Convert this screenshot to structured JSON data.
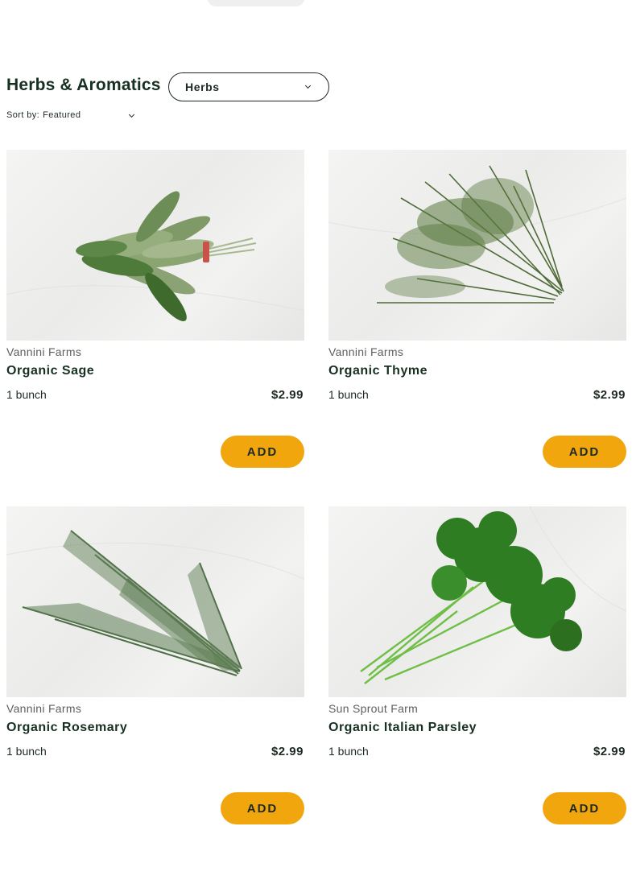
{
  "section": {
    "title": "Herbs & Aromatics",
    "category_select": "Herbs",
    "sort_label": "Sort by:",
    "sort_value": "Featured"
  },
  "products": [
    {
      "farm": "Vannini Farms",
      "name": "Organic Sage",
      "unit": "1 bunch",
      "price": "$2.99",
      "add_label": "ADD"
    },
    {
      "farm": "Vannini Farms",
      "name": "Organic Thyme",
      "unit": "1 bunch",
      "price": "$2.99",
      "add_label": "ADD"
    },
    {
      "farm": "Vannini Farms",
      "name": "Organic Rosemary",
      "unit": "1 bunch",
      "price": "$2.99",
      "add_label": "ADD"
    },
    {
      "farm": "Sun Sprout Farm",
      "name": "Organic Italian Parsley",
      "unit": "1 bunch",
      "price": "$2.99",
      "add_label": "ADD"
    }
  ],
  "colors": {
    "accent": "#f2a60d",
    "heading": "#173022",
    "text": "#1d2a22",
    "muted": "#5b5f5c"
  },
  "icons": [
    "chevron-down-icon"
  ]
}
